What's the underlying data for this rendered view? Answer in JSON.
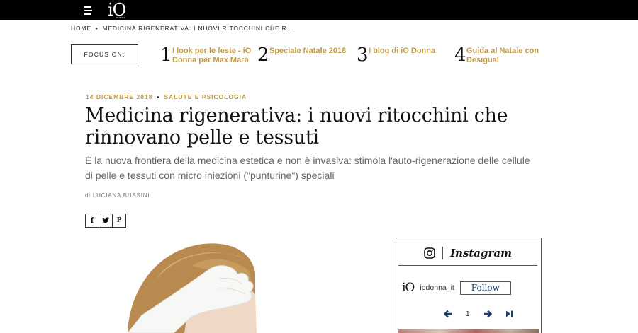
{
  "header": {
    "logo_text": "iO",
    "logo_sub": "DONNA"
  },
  "breadcrumb": {
    "home": "HOME",
    "separator": "•",
    "current": "MEDICINA RIGENERATIVA: I NUOVI RITOCCHINI CHE R..."
  },
  "focus": {
    "label": "FOCUS ON:",
    "items": [
      {
        "num": "1",
        "text": "I look per le feste - iO Donna per Max Mara"
      },
      {
        "num": "2",
        "text": "Speciale Natale 2018"
      },
      {
        "num": "3",
        "text": "I blog di iO Donna"
      },
      {
        "num": "4",
        "text": "Guida al Natale con Desigual"
      }
    ]
  },
  "article": {
    "date": "14 DICEMBRE 2018",
    "meta_separator": "•",
    "category": "SALUTE E PSICOLOGIA",
    "title": "Medicina rigenerativa: i nuovi ritocchini che rinnovano pelle e tessuti",
    "subtitle": "È la nuova frontiera della medicina estetica e non è invasiva: stimola l'auto-rigenerazione delle cellule di pelle e tessuti con micro iniezioni (\"punturine\") speciali",
    "author": "di LUCIANA BUSSINI"
  },
  "share": {
    "facebook": "f",
    "twitter_icon": "twitter-icon",
    "pinterest": "P"
  },
  "instagram": {
    "title": "Instagram",
    "user_logo": "iO",
    "handle": "iodonna_it",
    "follow_label": "Follow",
    "page": "1"
  },
  "colors": {
    "accent_gold": "#c19a45",
    "follow_blue": "#1a3c6e",
    "topbar": "#000000"
  }
}
